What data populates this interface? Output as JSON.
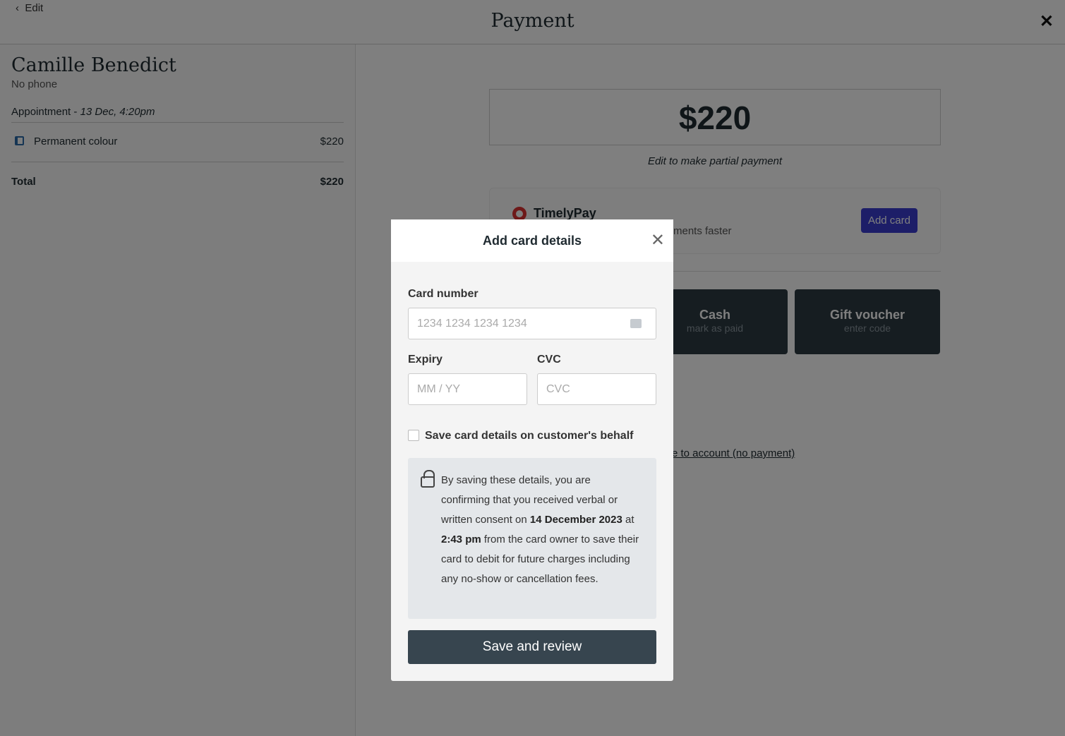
{
  "header": {
    "back_label": "Edit",
    "title": "Payment",
    "close_icon": "close-icon"
  },
  "customer": {
    "name": "Camille Benedict",
    "phone": "No phone",
    "appointment_label": "Appointment - ",
    "appointment_time": "13 Dec, 4:20pm",
    "items": [
      {
        "name": "Permanent colour",
        "price": "$220"
      }
    ],
    "total_label": "Total",
    "total": "$220"
  },
  "payment": {
    "amount": "$220",
    "partial_hint": "Edit to make partial payment",
    "timelypay": {
      "name": "TimelyPay",
      "subtitle_visible": "ments faster",
      "add_card": "Add card"
    },
    "methods": [
      {
        "label": "Cash",
        "sub": "mark as paid"
      },
      {
        "label": "Gift voucher",
        "sub": "enter code"
      }
    ],
    "account_link_visible": "e to account (no payment)"
  },
  "modal": {
    "title": "Add card details",
    "card_number_label": "Card number",
    "card_number_placeholder": "1234 1234 1234 1234",
    "expiry_label": "Expiry",
    "expiry_placeholder": "MM / YY",
    "cvc_label": "CVC",
    "cvc_placeholder": "CVC",
    "save_checkbox_label": "Save card details on customer's behalf",
    "save_checked": false,
    "consent": {
      "t1": "By saving these details, you are confirming that you received verbal or written consent on ",
      "date": "14 December 2023",
      "t2": " at ",
      "time": "2:43 pm",
      "t3": " from the card owner to save their card to debit for future charges including any no-show or cancellation fees."
    },
    "submit": "Save and review"
  },
  "colors": {
    "accent": "#3a3dd0",
    "dark_button": "#37454f",
    "timelypay": "#dd3333"
  }
}
